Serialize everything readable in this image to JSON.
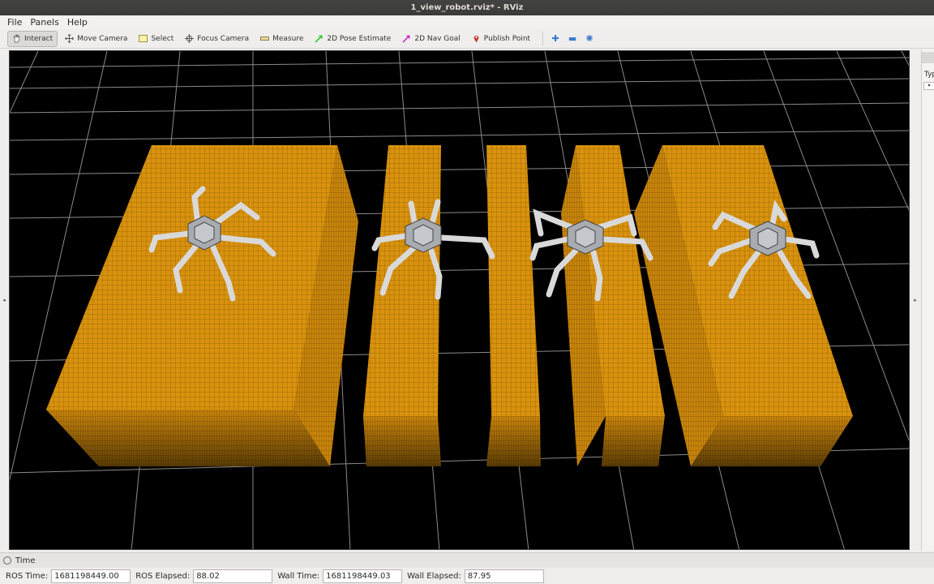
{
  "window": {
    "title": "1_view_robot.rviz* - RViz"
  },
  "menu": [
    {
      "label": "File"
    },
    {
      "label": "Panels"
    },
    {
      "label": "Help"
    }
  ],
  "toolbar": {
    "interact": "Interact",
    "move_camera": "Move Camera",
    "select": "Select",
    "focus_camera": "Focus Camera",
    "measure": "Measure",
    "pose_estimate": "2D Pose Estimate",
    "nav_goal": "2D Nav Goal",
    "publish_point": "Publish Point",
    "accent_pose": "#33cc33",
    "accent_nav": "#cc33cc",
    "accent_point": "#c0392b"
  },
  "scene": {
    "background": "#000000",
    "grid_color": "#9a9a9a",
    "block_color": "#d8920e",
    "robot_count": 4
  },
  "right_panel": {
    "type_label": "Typ"
  },
  "time_panel": {
    "title": "Time"
  },
  "status": {
    "ros_time_label": "ROS Time:",
    "ros_time": "1681198449.00",
    "ros_elapsed_label": "ROS Elapsed:",
    "ros_elapsed": "88.02",
    "wall_time_label": "Wall Time:",
    "wall_time": "1681198449.03",
    "wall_elapsed_label": "Wall Elapsed:",
    "wall_elapsed": "87.95"
  }
}
